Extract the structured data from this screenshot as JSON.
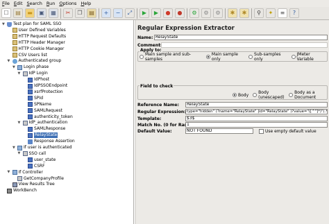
{
  "menu": [
    "File",
    "Edit",
    "Search",
    "Run",
    "Options",
    "Help"
  ],
  "toolbar": {
    "buttons": [
      {
        "icon": "new-icon",
        "glyph": "☐",
        "color": "#ffffff",
        "fg": "#555555"
      },
      {
        "icon": "templates-icon",
        "glyph": "▤",
        "color": "#e8e4d8",
        "fg": "#9a7b3c"
      },
      {
        "icon": "open-icon",
        "glyph": "▬",
        "color": "#f2d27a",
        "fg": "#c9961e"
      },
      {
        "icon": "save-icon",
        "glyph": "▣",
        "color": "#dfe3ea",
        "fg": "#4a5a7a"
      },
      {
        "icon": "save-screenshot-icon",
        "glyph": "▦",
        "color": "#dfe3ea",
        "fg": "#4a5a7a"
      },
      {
        "sep": true
      },
      {
        "icon": "cut-icon",
        "glyph": "✂",
        "color": "#e8e6e2",
        "fg": "#c0392b"
      },
      {
        "icon": "copy-icon",
        "glyph": "❐",
        "color": "#e8e6e2",
        "fg": "#555555"
      },
      {
        "icon": "paste-icon",
        "glyph": "▤",
        "color": "#e8d9a8",
        "fg": "#7a5a1e"
      },
      {
        "sep": true
      },
      {
        "icon": "expand-icon",
        "glyph": "+",
        "color": "#d8e4f4",
        "fg": "#2c5aa0"
      },
      {
        "icon": "collapse-icon",
        "glyph": "−",
        "color": "#d8e4f4",
        "fg": "#2c5aa0"
      },
      {
        "icon": "toggle-icon",
        "glyph": "⤢",
        "color": "#e8e6e2",
        "fg": "#2c5aa0"
      },
      {
        "sep": true
      },
      {
        "icon": "start-icon",
        "glyph": "▶",
        "color": "#e8e6e2",
        "fg": "#2aa63a"
      },
      {
        "icon": "start-no-pause-icon",
        "glyph": "▶",
        "color": "#e8e6e2",
        "fg": "#2aa63a"
      },
      {
        "icon": "stop-icon",
        "glyph": "●",
        "color": "#e8e6e2",
        "fg": "#cf3a2a"
      },
      {
        "icon": "shutdown-icon",
        "glyph": "●",
        "color": "#e8e6e2",
        "fg": "#c0392b"
      },
      {
        "sep": true
      },
      {
        "icon": "remote-start-icon",
        "glyph": "⚙",
        "color": "#e8e6e2",
        "fg": "#2aa63a"
      },
      {
        "icon": "remote-stop-icon",
        "glyph": "⚙",
        "color": "#e8e6e2",
        "fg": "#888888"
      },
      {
        "icon": "remote-exit-icon",
        "glyph": "⚙",
        "color": "#e8e6e2",
        "fg": "#888888"
      },
      {
        "sep": true
      },
      {
        "icon": "clear-icon",
        "glyph": "✱",
        "color": "#f0e2b0",
        "fg": "#b08a2a"
      },
      {
        "icon": "clear-all-icon",
        "glyph": "✱",
        "color": "#f0e2b0",
        "fg": "#b08a2a"
      },
      {
        "sep": true
      },
      {
        "icon": "search-icon",
        "glyph": "⚲",
        "color": "#e8e6e2",
        "fg": "#333333"
      },
      {
        "icon": "reset-search-icon",
        "glyph": "✦",
        "color": "#e8e6e2",
        "fg": "#c0a000"
      },
      {
        "icon": "function-helper-icon",
        "glyph": "≡",
        "color": "#ffffff",
        "fg": "#555555"
      },
      {
        "icon": "help-icon",
        "glyph": "?",
        "color": "#e8e6e2",
        "fg": "#2c5aa0"
      }
    ]
  },
  "tree": [
    {
      "label": "Test plan for SAML SSO",
      "depth": 0,
      "icon": "flask-icon",
      "twisty": "open"
    },
    {
      "label": "User Defined Variables",
      "depth": 1,
      "icon": "config-icon"
    },
    {
      "label": "HTTP Request Defaults",
      "depth": 1,
      "icon": "config-icon"
    },
    {
      "label": "HTTP Header Manager",
      "depth": 1,
      "icon": "config-icon"
    },
    {
      "label": "HTTP Cookie Manager",
      "depth": 1,
      "icon": "config-icon"
    },
    {
      "label": "CSV Users list",
      "depth": 1,
      "icon": "config-icon"
    },
    {
      "label": "Authenticated group",
      "depth": 1,
      "icon": "thread-group-icon",
      "twisty": "open"
    },
    {
      "label": "Login phase",
      "depth": 2,
      "icon": "controller-icon",
      "twisty": "open"
    },
    {
      "label": "IdP Login",
      "depth": 3,
      "icon": "sampler-icon",
      "twisty": "open"
    },
    {
      "label": "IdPhost",
      "depth": 4,
      "icon": "extractor-icon"
    },
    {
      "label": "IdPSSOEndpoint",
      "depth": 4,
      "icon": "extractor-icon"
    },
    {
      "label": "xsrfProtection",
      "depth": 4,
      "icon": "extractor-icon"
    },
    {
      "label": "SPId",
      "depth": 4,
      "icon": "extractor-icon"
    },
    {
      "label": "SPName",
      "depth": 4,
      "icon": "extractor-icon"
    },
    {
      "label": "SAMLRequest",
      "depth": 4,
      "icon": "extractor-icon"
    },
    {
      "label": "authenticity_token",
      "depth": 4,
      "icon": "extractor-icon"
    },
    {
      "label": "IdP_authentication",
      "depth": 3,
      "icon": "sampler-icon",
      "twisty": "open"
    },
    {
      "label": "SAMLResponse",
      "depth": 4,
      "icon": "extractor-icon"
    },
    {
      "label": "RelayState",
      "depth": 4,
      "icon": "extractor-icon",
      "selected": true
    },
    {
      "label": "Response Assertion",
      "depth": 4,
      "icon": "assertion-icon"
    },
    {
      "label": "If user is authenticated",
      "depth": 2,
      "icon": "controller-icon",
      "twisty": "open"
    },
    {
      "label": "SSO call",
      "depth": 3,
      "icon": "sampler-icon",
      "twisty": "open"
    },
    {
      "label": "user_state",
      "depth": 4,
      "icon": "extractor-icon"
    },
    {
      "label": "CSRF",
      "depth": 4,
      "icon": "extractor-icon"
    },
    {
      "label": "If Controller",
      "depth": 1,
      "icon": "controller-icon",
      "twisty": "open"
    },
    {
      "label": "GetCompanyProfile",
      "depth": 2,
      "icon": "sampler-icon"
    },
    {
      "label": "View Results Tree",
      "depth": 1,
      "icon": "listener-icon"
    },
    {
      "label": "WorkBench",
      "depth": 0,
      "icon": "workbench-icon"
    }
  ],
  "editor": {
    "title": "Regular Expression Extractor",
    "name_label": "Name:",
    "name_value": "RelayState",
    "comments_label": "Comments:",
    "comments_value": "",
    "apply_to_legend": "Apply to:",
    "apply_to_options": [
      "Main sample and sub-samples",
      "Main sample only",
      "Sub-samples only",
      "JMeter Variable"
    ],
    "apply_to_selected": 1,
    "field_legend": "Field to check",
    "field_options": [
      "Body",
      "Body (unescaped)",
      "Body as a Document"
    ],
    "field_selected": 0,
    "ref_label": "Reference Name:",
    "ref_value": "RelayState",
    "regex_label": "Regular Expression:",
    "regex_value": "type=\"hidden\" (?name=\"RelayState\" |id=\"RelayState\" )?value=\"([^\"]*)\"(.*)/>",
    "template_label": "Template:",
    "template_value": "$3$",
    "match_label": "Match No. (0 for Random):",
    "match_value": "1",
    "default_label": "Default Value:",
    "default_value": "NOT FOUND",
    "empty_default_label": "Use empty default value"
  },
  "colors": {
    "selection": "#3d6fb4",
    "tree_line": "#a0a0a0"
  }
}
